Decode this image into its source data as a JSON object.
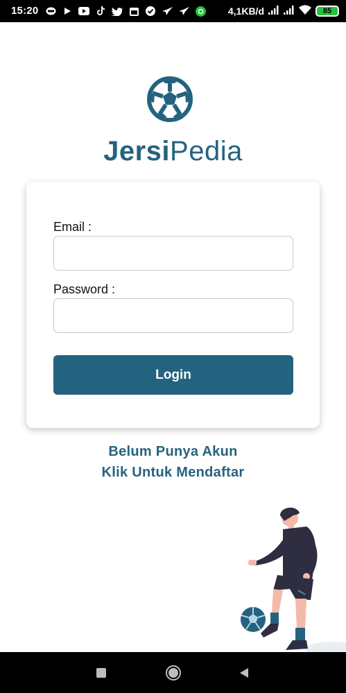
{
  "status_bar": {
    "time": "15:20",
    "network_speed": "4,1KB/d",
    "battery": "85",
    "notification_icons": [
      "line-icon",
      "play-icon",
      "youtube-icon",
      "tiktok-icon",
      "twitter-icon",
      "calendar-icon",
      "check-icon",
      "bird-icon",
      "bird-icon",
      "vpn-icon"
    ]
  },
  "app": {
    "title_bold": "Jersi",
    "title_regular": "Pedia",
    "brand_color": "#24637f"
  },
  "form": {
    "email_label": "Email :",
    "email_value": "",
    "password_label": "Password :",
    "password_value": "",
    "login_button": "Login"
  },
  "register": {
    "line1": "Belum Punya Akun",
    "line2": "Klik Untuk Mendaftar"
  },
  "nav": {
    "icons": [
      "recent-apps-icon",
      "home-icon",
      "back-icon"
    ]
  }
}
